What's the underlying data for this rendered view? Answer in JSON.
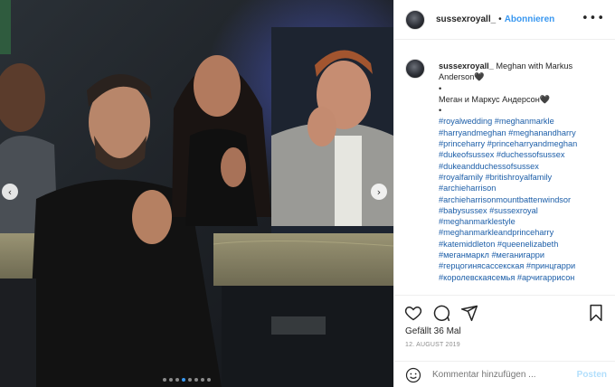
{
  "post": {
    "username": "sussexroyall_",
    "separator": "•",
    "follow_label": "Abonnieren",
    "more_icon": "more-options-icon"
  },
  "caption": {
    "username": "sussexroyall_",
    "line1": "Meghan with Markus Anderson🖤",
    "bullet1": "•",
    "line2": "Меган и Маркус Андерсон🖤",
    "bullet2": "•",
    "hashtags": [
      "#royalwedding #meghanmarkle",
      "#harryandmeghan #meghanandharry",
      "#princeharry #princeharryandmeghan",
      "#dukeofsussex #duchessofsussex",
      "#dukeandduchessofsussex",
      "#royalfamily #britishroyalfamily",
      "#archieharrison",
      "#archieharrisonmountbattenwindsor",
      "#babysussex #sussexroyal",
      "#meghanmarklestyle",
      "#meghanmarkleandprinceharry",
      "#katemiddleton #queenelizabeth",
      "#меганмаркл #меганигарри",
      "#герцогинясассекская #принцгарри",
      "#королевскаясемья #арчигаррисон"
    ]
  },
  "actions": {
    "likes": "Gefällt 36 Mal",
    "date": "12. AUGUST 2019",
    "comment_placeholder": "Kommentar hinzufügen ...",
    "post_label": "Posten"
  },
  "carousel": {
    "prev_label": "‹",
    "next_label": "›",
    "dot_count": 8,
    "active_index": 3
  }
}
